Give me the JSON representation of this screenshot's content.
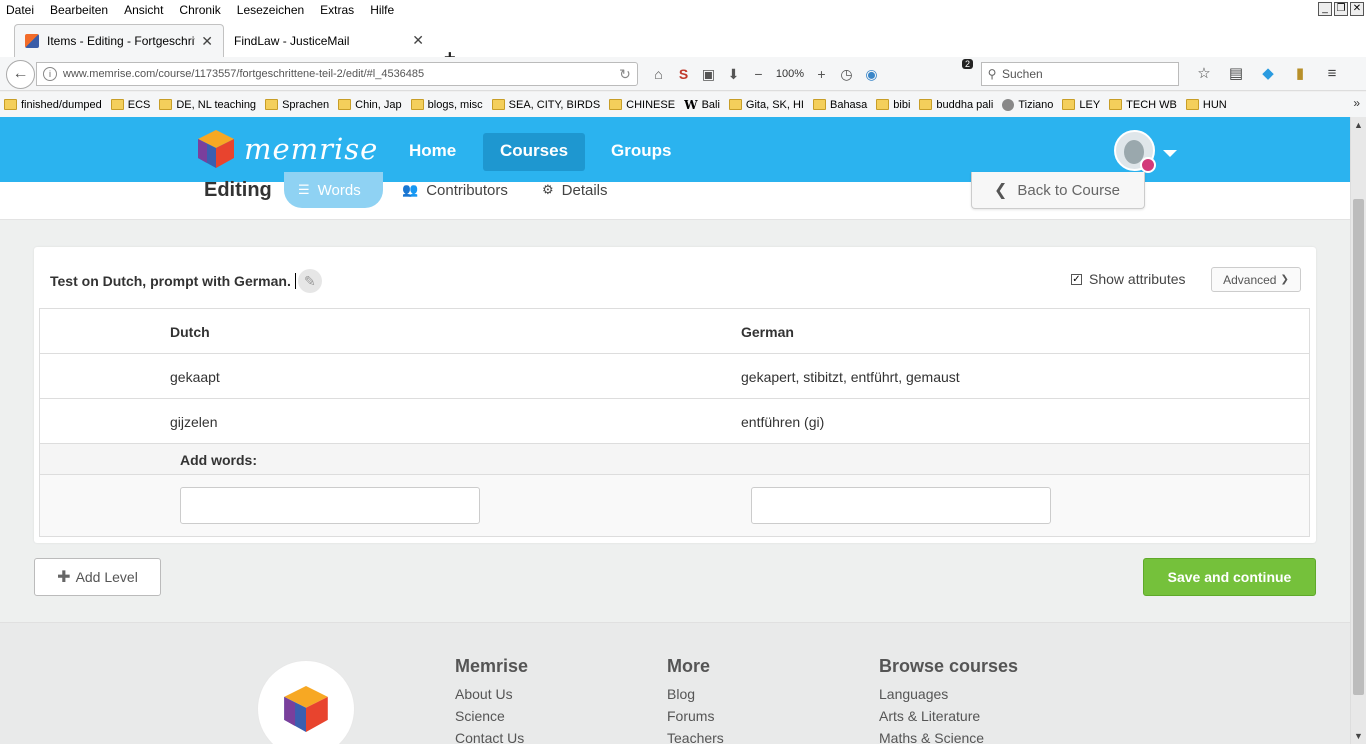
{
  "browser": {
    "menu": [
      "Datei",
      "Bearbeiten",
      "Ansicht",
      "Chronik",
      "Lesezeichen",
      "Extras",
      "Hilfe"
    ],
    "tabs": [
      {
        "title": "Items - Editing - Fortgeschritt…",
        "close": "✕"
      },
      {
        "title": "FindLaw - JusticeMail",
        "close": "✕"
      }
    ],
    "new_tab": "+",
    "url": "www.memrise.com/course/1173557/fortgeschrittene-teil-2/edit/#l_4536485",
    "zoom": "100%",
    "notification_count": "2",
    "search_placeholder": "Suchen",
    "bookmarks": [
      {
        "label": "finished/dumped",
        "icon": "folder-icon"
      },
      {
        "label": "ECS",
        "icon": "folder-icon"
      },
      {
        "label": "DE, NL teaching",
        "icon": "folder-icon"
      },
      {
        "label": "Sprachen",
        "icon": "folder-icon"
      },
      {
        "label": "Chin, Jap",
        "icon": "folder-icon"
      },
      {
        "label": "blogs, misc",
        "icon": "folder-icon"
      },
      {
        "label": "SEA, CITY, BIRDS",
        "icon": "folder-icon"
      },
      {
        "label": "CHINESE",
        "icon": "folder-icon"
      },
      {
        "label": "Bali",
        "icon": "wikipedia-icon"
      },
      {
        "label": "Gita, SK, HI",
        "icon": "folder-icon"
      },
      {
        "label": "Bahasa",
        "icon": "folder-icon"
      },
      {
        "label": "bibi",
        "icon": "folder-icon"
      },
      {
        "label": "buddha pali",
        "icon": "folder-icon"
      },
      {
        "label": "Tiziano",
        "icon": "globe-icon"
      },
      {
        "label": "LEY",
        "icon": "folder-icon"
      },
      {
        "label": "TECH WB",
        "icon": "folder-icon"
      },
      {
        "label": "HUN",
        "icon": "folder-icon"
      }
    ]
  },
  "site": {
    "logo_text": "memrise",
    "nav": {
      "home": "Home",
      "courses": "Courses",
      "groups": "Groups"
    },
    "brand_color": "#2bb3ef"
  },
  "subnav": {
    "title": "Editing",
    "tabs": {
      "words": "Words",
      "contributors": "Contributors",
      "details": "Details"
    },
    "back_to_course": "Back to Course"
  },
  "level": {
    "heading": "Test on Dutch, prompt with German.",
    "show_attributes_label": "Show attributes",
    "show_attributes_checked": "✓",
    "advanced_label": "Advanced",
    "columns": {
      "col1": "Dutch",
      "col2": "German"
    },
    "rows": [
      {
        "dutch": "gekaapt",
        "german": "gekapert, stibitzt, entführt, gemaust"
      },
      {
        "dutch": "gijzelen",
        "german": "entführen (gi)"
      }
    ],
    "add_words_label": "Add words:",
    "dutch_input_value": "",
    "german_input_value": ""
  },
  "actions": {
    "add_level": "Add Level",
    "save_continue": "Save and continue",
    "save_color": "#75c13b"
  },
  "footer": {
    "col1": {
      "title": "Memrise",
      "links": [
        "About Us",
        "Science",
        "Contact Us"
      ]
    },
    "col2": {
      "title": "More",
      "links": [
        "Blog",
        "Forums",
        "Teachers"
      ]
    },
    "col3": {
      "title": "Browse courses",
      "links": [
        "Languages",
        "Arts & Literature",
        "Maths & Science"
      ]
    }
  }
}
